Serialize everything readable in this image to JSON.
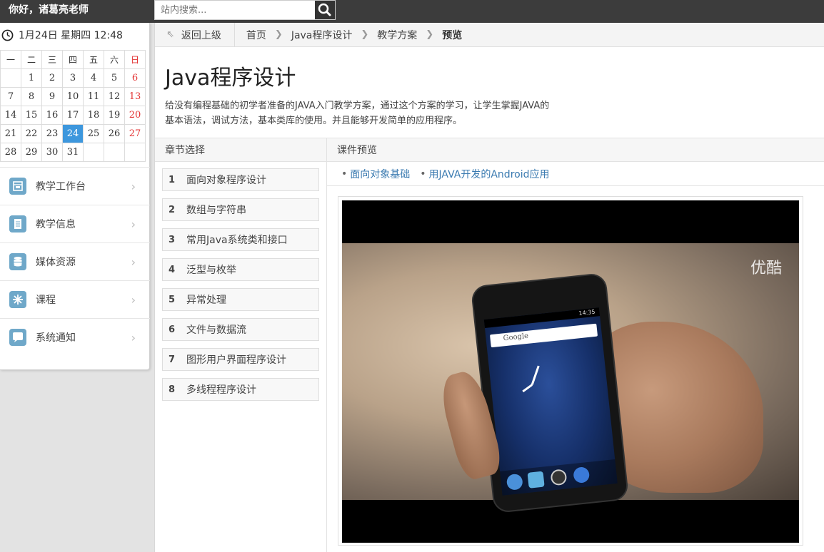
{
  "topbar": {
    "greeting": "你好，诸葛亮老师",
    "search_placeholder": "站内搜索..."
  },
  "sidebar": {
    "datetime": "1月24日 星期四 12:48",
    "calendar": {
      "weekdays": [
        "一",
        "二",
        "三",
        "四",
        "五",
        "六",
        "日"
      ],
      "weeks": [
        [
          "",
          "1",
          "2",
          "3",
          "4",
          "5",
          "6"
        ],
        [
          "7",
          "8",
          "9",
          "10",
          "11",
          "12",
          "13"
        ],
        [
          "14",
          "15",
          "16",
          "17",
          "18",
          "19",
          "20"
        ],
        [
          "21",
          "22",
          "23",
          "24",
          "25",
          "26",
          "27"
        ],
        [
          "28",
          "29",
          "30",
          "31",
          "",
          "",
          ""
        ]
      ],
      "today": "24",
      "today_color": "#3d97dd",
      "weekend_color": "#e33333"
    },
    "menu": [
      {
        "label": "教学工作台",
        "icon": "workbench-icon"
      },
      {
        "label": "教学信息",
        "icon": "document-icon"
      },
      {
        "label": "媒体资源",
        "icon": "database-icon"
      },
      {
        "label": "课程",
        "icon": "snowflake-icon"
      },
      {
        "label": "系统通知",
        "icon": "chat-bubble-icon"
      }
    ]
  },
  "breadcrumb": {
    "back": "返回上级",
    "items": [
      "首页",
      "Java程序设计",
      "教学方案"
    ],
    "current": "预览"
  },
  "course": {
    "title": "Java程序设计",
    "description_line1": "给没有编程基础的初学者准备的JAVA入门教学方案，通过这个方案的学习，让学生掌握JAVA的",
    "description_line2": "基本语法，调试方法，基本类库的使用。并且能够开发简单的应用程序。"
  },
  "chapters": {
    "heading": "章节选择",
    "items": [
      {
        "num": "1",
        "title": "面向对象程序设计"
      },
      {
        "num": "2",
        "title": "数组与字符串"
      },
      {
        "num": "3",
        "title": "常用Java系统类和接口"
      },
      {
        "num": "4",
        "title": "泛型与枚举"
      },
      {
        "num": "5",
        "title": "异常处理"
      },
      {
        "num": "6",
        "title": "文件与数据流"
      },
      {
        "num": "7",
        "title": "图形用户界面程序设计"
      },
      {
        "num": "8",
        "title": "多线程程序设计"
      }
    ]
  },
  "preview": {
    "heading": "课件预览",
    "links": [
      "面向对象基础",
      "用JAVA开发的Android应用"
    ],
    "video_watermark": "优酷",
    "phone_search_text": "Google",
    "phone_status_time": "14:35",
    "link_color": "#3a7ab0"
  }
}
